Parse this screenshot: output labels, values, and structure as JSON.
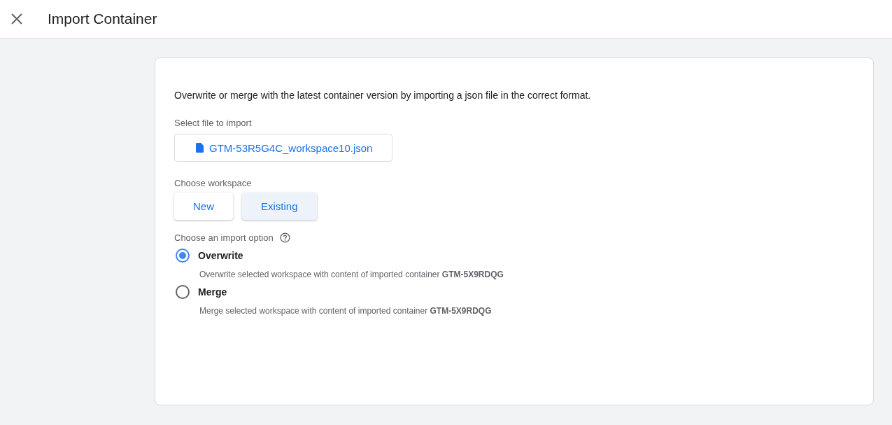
{
  "header": {
    "title": "Import Container"
  },
  "description": "Overwrite or merge with the latest container version by importing a json file in the correct format.",
  "file": {
    "label": "Select file to import",
    "filename": "GTM-53R5G4C_workspace10.json"
  },
  "workspace": {
    "label": "Choose workspace",
    "options": [
      {
        "label": "New",
        "selected": false
      },
      {
        "label": "Existing",
        "selected": true
      }
    ]
  },
  "import_option": {
    "label": "Choose an import option",
    "options": [
      {
        "label": "Overwrite",
        "selected": true,
        "description": "Overwrite selected workspace with content of imported container **GTM-5X9RDQG**"
      },
      {
        "label": "Merge",
        "selected": false,
        "description": "Merge selected workspace with content of imported container **GTM-5X9RDQG**"
      }
    ]
  }
}
